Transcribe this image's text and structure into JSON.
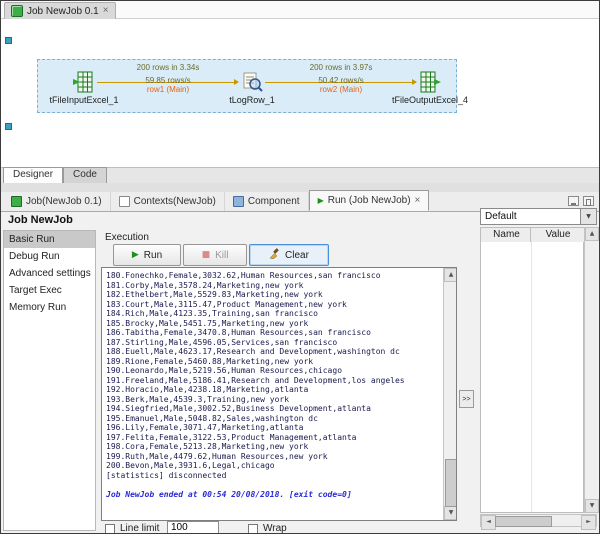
{
  "editor": {
    "tab_label": "Job NewJob 0.1"
  },
  "icons": {
    "close": "×",
    "dropdown_arrow": "▼",
    "scroll_up": "▲",
    "scroll_down": "▼",
    "scroll_left": "◄",
    "scroll_right": "►",
    "run_play": "▶",
    "kill_stop": "■",
    "expand": ">>"
  },
  "canvas": {
    "components": [
      {
        "label": "tFileInputExcel_1"
      },
      {
        "label": "tLogRow_1"
      },
      {
        "label": "tFileOutputExcel_4"
      }
    ],
    "connections": [
      {
        "stats": "200 rows in 3.34s",
        "rate": "59.85 rows/s",
        "label": "row1 (Main)"
      },
      {
        "stats": "200 rows in 3.97s",
        "rate": "50.42 rows/s",
        "label": "row2 (Main)"
      }
    ]
  },
  "view_tabs": {
    "designer": "Designer",
    "code": "Code"
  },
  "panel_tabs": [
    {
      "label": "Job(NewJob 0.1)"
    },
    {
      "label": "Contexts(NewJob)"
    },
    {
      "label": "Component"
    },
    {
      "label": "Run (Job NewJob)"
    }
  ],
  "run": {
    "title": "Job NewJob",
    "nav": [
      "Basic Run",
      "Debug Run",
      "Advanced settings",
      "Target Exec",
      "Memory Run"
    ],
    "execution_label": "Execution",
    "run_button": "Run",
    "kill_button": "Kill",
    "clear_button": "Clear",
    "console_lines": [
      "180.Fonechko,Female,3032.62,Human Resources,san francisco",
      "181.Corby,Male,3578.24,Marketing,new york",
      "182.Ethelbert,Male,5529.83,Marketing,new york",
      "183.Court,Male,3115.47,Product Management,new york",
      "184.Rich,Male,4123.35,Training,san francisco",
      "185.Brocky,Male,5451.75,Marketing,new york",
      "186.Tabitha,Female,3470.8,Human Resources,san francisco",
      "187.Stirling,Male,4596.05,Services,san francisco",
      "188.Euell,Male,4623.17,Research and Development,washington dc",
      "189.Rione,Female,5460.88,Marketing,new york",
      "190.Leonardo,Male,5219.56,Human Resources,chicago",
      "191.Freeland,Male,5186.41,Research and Development,los angeles",
      "192.Horacio,Male,4238.18,Marketing,atlanta",
      "193.Berk,Male,4539.3,Training,new york",
      "194.Siegfried,Male,3002.52,Business Development,atlanta",
      "195.Emanuel,Male,5048.82,Sales,washington dc",
      "196.Lily,Female,3071.47,Marketing,atlanta",
      "197.Felita,Female,3122.53,Product Management,atlanta",
      "198.Cora,Female,5213.28,Marketing,new york",
      "199.Ruth,Male,4479.62,Human Resources,new york",
      "200.Bevon,Male,3931.6,Legal,chicago",
      "[statistics] disconnected"
    ],
    "ended_line": "Job NewJob ended at 00:54 20/08/2018. [exit code=0]",
    "line_limit_label": "Line limit",
    "line_limit_value": "100",
    "wrap_label": "Wrap"
  },
  "right_panel": {
    "preset": "Default",
    "name_column": "Name",
    "value_column": "Value"
  }
}
